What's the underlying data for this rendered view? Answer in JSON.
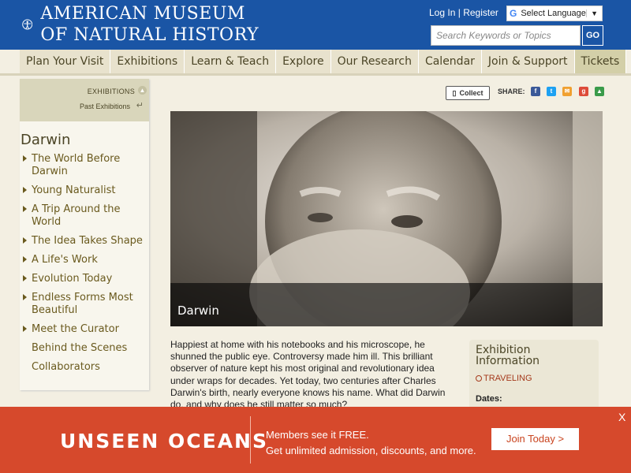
{
  "header": {
    "logo_line1": "AMERICAN MUSEUM",
    "logo_line2": "OF NATURAL HISTORY",
    "login": "Log In",
    "separator": "|",
    "register": "Register",
    "language_label": "Select Language",
    "search_placeholder": "Search Keywords or Topics",
    "go_label": "GO"
  },
  "nav": [
    "Plan Your Visit",
    "Exhibitions",
    "Learn & Teach",
    "Explore",
    "Our Research",
    "Calendar",
    "Join & Support",
    "Tickets"
  ],
  "sidebar": {
    "exhibitions_label": "EXHIBITIONS",
    "past_label": "Past Exhibitions",
    "title": "Darwin",
    "items": [
      "The World Before Darwin",
      "Young Naturalist",
      "A Trip Around the World",
      "The Idea Takes Shape",
      "A Life's Work",
      "Evolution Today",
      "Endless Forms Most Beautiful",
      "Meet the Curator",
      "Behind the Scenes",
      "Collaborators"
    ]
  },
  "share": {
    "collect_label": "Collect",
    "share_label": "SHARE:"
  },
  "hero": {
    "caption": "Darwin"
  },
  "body_text": "Happiest at home with his notebooks and his microscope, he shunned the public eye. Controversy made him ill. This brilliant observer of nature kept his most original and revolutionary idea under wraps for decades. Yet today, two centuries after Charles Darwin's birth, nearly everyone knows his name. What did Darwin do, and why does he still matter so much?",
  "info": {
    "title": "Exhibition Information",
    "traveling": "TRAVELING",
    "dates_label": "Dates:"
  },
  "banner": {
    "title": "UNSEEN OCEANS",
    "line1": "Members see it FREE.",
    "line2": "Get unlimited admission, discounts, and more.",
    "button": "Join Today >",
    "close": "X"
  },
  "colors": {
    "header_blue": "#1a55a5",
    "nav_bg": "#e8e2cd",
    "banner_red": "#d6492c",
    "text_brown": "#4b4526"
  }
}
